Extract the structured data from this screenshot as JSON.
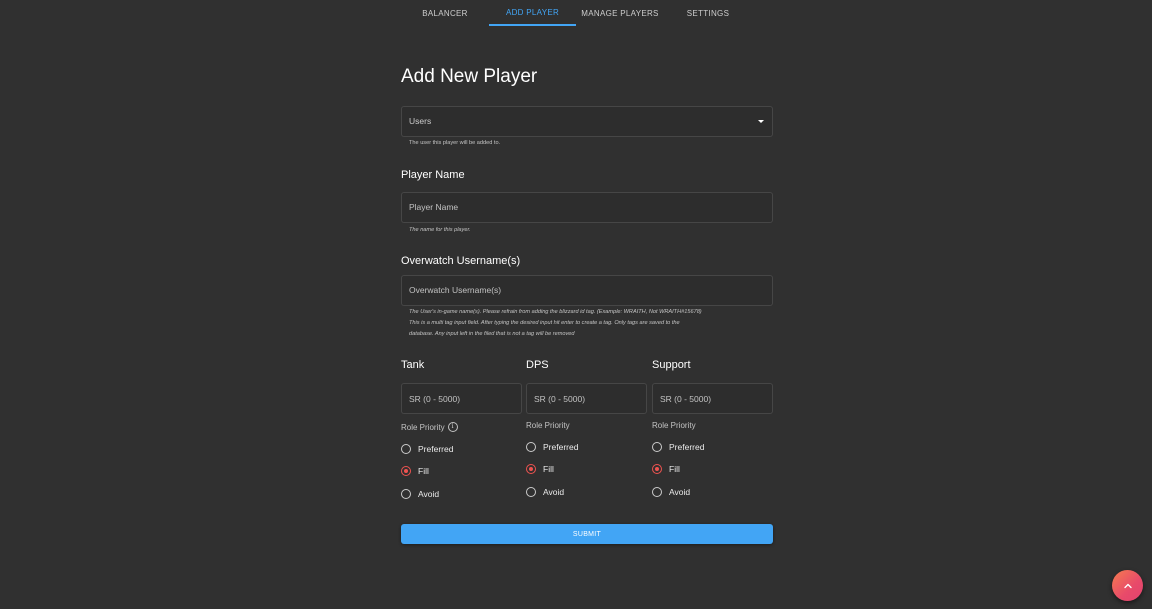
{
  "tabs": [
    {
      "label": "BALANCER",
      "active": false
    },
    {
      "label": "ADD PLAYER",
      "active": true
    },
    {
      "label": "MANAGE PLAYERS",
      "active": false
    },
    {
      "label": "SETTINGS",
      "active": false
    }
  ],
  "form": {
    "title": "Add New Player",
    "users_select": {
      "value": "Users",
      "helper": "The user this player will be added to."
    },
    "player_name": {
      "section_title": "Player Name",
      "placeholder": "Player Name",
      "helper": "The name for this player."
    },
    "overwatch": {
      "section_title": "Overwatch Username(s)",
      "placeholder": "Overwatch Username(s)",
      "helper_lines": [
        "The User's in-game name(s). Please refrain from adding the blizzard id tag. (Example: WRAITH, Not WRAITH#15678)",
        "This is a multi tag input field. After typing the desired input hit enter to create a tag. Only tags are saved to the",
        "database. Any input left in the filed that is not a tag will be removed"
      ]
    },
    "roles": [
      {
        "name": "Tank",
        "sr_placeholder": "SR (0 - 5000)",
        "priority_label": "Role Priority",
        "has_info": true,
        "options": [
          "Preferred",
          "Fill",
          "Avoid"
        ],
        "selected": "Fill"
      },
      {
        "name": "DPS",
        "sr_placeholder": "SR (0 - 5000)",
        "priority_label": "Role Priority",
        "has_info": false,
        "options": [
          "Preferred",
          "Fill",
          "Avoid"
        ],
        "selected": "Fill"
      },
      {
        "name": "Support",
        "sr_placeholder": "SR (0 - 5000)",
        "priority_label": "Role Priority",
        "has_info": false,
        "options": [
          "Preferred",
          "Fill",
          "Avoid"
        ],
        "selected": "Fill"
      }
    ],
    "submit_label": "SUBMIT"
  },
  "fab": {
    "icon": "chevron-up-icon"
  },
  "colors": {
    "background": "#303030",
    "accent": "#42a5f5",
    "radio_selected": "#ef5350",
    "fab_gradient_start": "#f57c4f",
    "fab_gradient_end": "#e0426e"
  }
}
